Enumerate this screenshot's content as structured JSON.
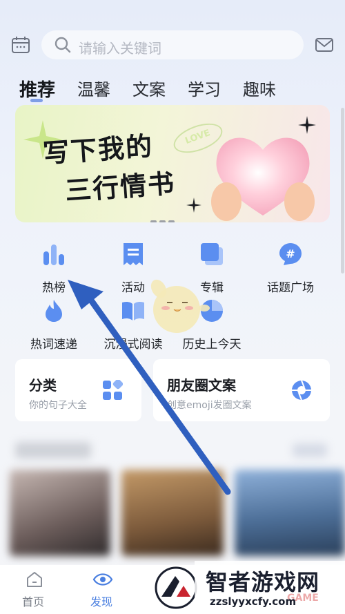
{
  "search": {
    "placeholder": "请输入关键词"
  },
  "tabs": [
    {
      "label": "推荐",
      "active": true
    },
    {
      "label": "温馨"
    },
    {
      "label": "文案"
    },
    {
      "label": "学习"
    },
    {
      "label": "趣味"
    }
  ],
  "banner": {
    "line1": "写下我的",
    "line2": "三行情书",
    "badge": "LOVE"
  },
  "features": [
    {
      "label": "热榜",
      "icon": "chart-bars-icon"
    },
    {
      "label": "活动",
      "icon": "receipt-icon"
    },
    {
      "label": "专辑",
      "icon": "album-icon"
    },
    {
      "label": "话题广场",
      "icon": "hashtag-icon"
    },
    {
      "label": "热词速递",
      "icon": "flame-icon"
    },
    {
      "label": "沉浸式阅读",
      "icon": "book-icon"
    },
    {
      "label": "历史上今天",
      "icon": "pie-clock-icon"
    }
  ],
  "cards": [
    {
      "title": "分类",
      "subtitle": "你的句子大全",
      "icon": "grid-icon"
    },
    {
      "title": "朋友圈文案",
      "subtitle": "创意emoji发圈文案",
      "icon": "camera-aperture-icon"
    }
  ],
  "bottom_nav": [
    {
      "label": "首页",
      "icon": "home-icon",
      "active": false
    },
    {
      "label": "发现",
      "icon": "eye-icon",
      "active": true
    }
  ],
  "watermark": {
    "name": "智者游戏网",
    "url": "zzslyyxcfy.com",
    "overlay": "GAME"
  },
  "colors": {
    "accent": "#4a7fe0",
    "icon_blue": "#5b8ef0",
    "arrow": "#2f5fbf"
  }
}
